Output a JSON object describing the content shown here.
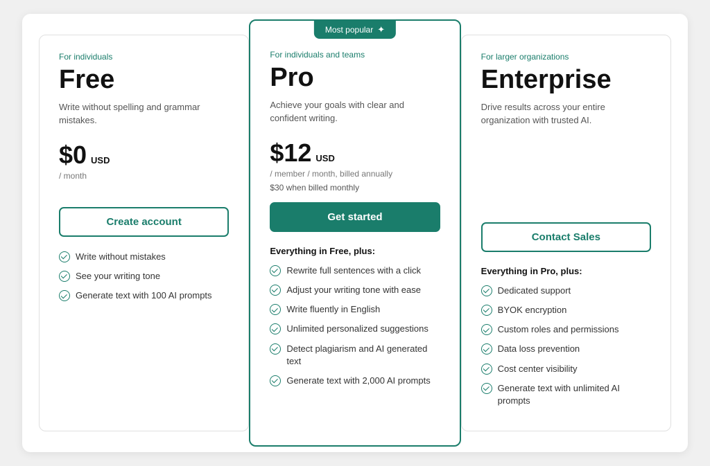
{
  "plans": [
    {
      "id": "free",
      "audience": "For individuals",
      "name": "Free",
      "description": "Write without spelling and grammar mistakes.",
      "price": "$0",
      "price_usd": "USD",
      "period": "/ month",
      "monthly_note": null,
      "button_label": "Create account",
      "button_type": "outline",
      "features_header": null,
      "features": [
        "Write without mistakes",
        "See your writing tone",
        "Generate text with 100 AI prompts"
      ]
    },
    {
      "id": "pro",
      "audience": "For individuals and teams",
      "name": "Pro",
      "description": "Achieve your goals with clear and confident writing.",
      "price": "$12",
      "price_usd": "USD",
      "period": "/ member / month, billed annually",
      "monthly_note": "$30 when billed monthly",
      "button_label": "Get started",
      "button_type": "solid",
      "most_popular": "Most popular",
      "features_header": "Everything in Free, plus:",
      "features": [
        "Rewrite full sentences with a click",
        "Adjust your writing tone with ease",
        "Write fluently in English",
        "Unlimited personalized suggestions",
        "Detect plagiarism and AI generated text",
        "Generate text with 2,000 AI prompts"
      ]
    },
    {
      "id": "enterprise",
      "audience": "For larger organizations",
      "name": "Enterprise",
      "description": "Drive results across your entire organization with trusted AI.",
      "price": null,
      "price_usd": null,
      "period": null,
      "monthly_note": null,
      "button_label": "Contact Sales",
      "button_type": "outline",
      "features_header": "Everything in Pro, plus:",
      "features": [
        "Dedicated support",
        "BYOK encryption",
        "Custom roles and permissions",
        "Data loss prevention",
        "Cost center visibility",
        "Generate text with unlimited AI prompts"
      ]
    }
  ]
}
